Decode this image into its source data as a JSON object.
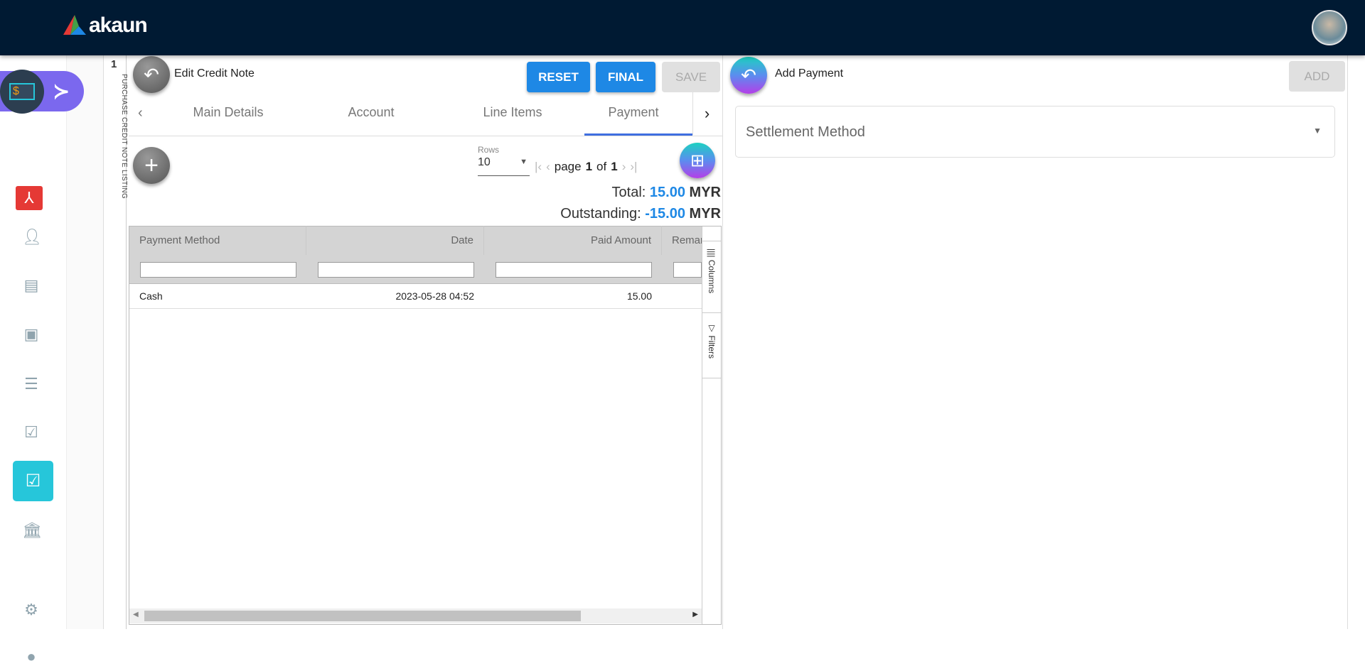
{
  "app": {
    "logo_text": "akaun"
  },
  "sidebar": {
    "items": [
      "billing",
      "pdf",
      "contacts",
      "card",
      "display",
      "receipt",
      "doc-check",
      "credit-note",
      "bank",
      "settings",
      "profile"
    ]
  },
  "vertical_tab": {
    "count": "1",
    "label": "PURCHASE CREDIT NOTE LISTING"
  },
  "edit": {
    "title": "Edit Credit Note",
    "reset": "RESET",
    "final": "FINAL",
    "save": "SAVE",
    "tabs": [
      "Main Details",
      "Account",
      "Line Items",
      "Payment"
    ],
    "rows_label": "Rows",
    "rows_value": "10",
    "page_word": "page",
    "page": "1",
    "of_word": "of",
    "pages": "1",
    "total_label": "Total:",
    "total_value": "15.00",
    "total_currency": "MYR",
    "outstanding_label": "Outstanding:",
    "outstanding_value": "-15.00",
    "outstanding_currency": "MYR",
    "columns": [
      "Payment Method",
      "Date",
      "Paid Amount",
      "Remarks"
    ],
    "rows": [
      {
        "method": "Cash",
        "date": "2023-05-28 04:52",
        "amount": "15.00",
        "remarks": ""
      }
    ],
    "side_columns": "Columns",
    "side_filters": "Filters"
  },
  "payment": {
    "title": "Add Payment",
    "add": "ADD",
    "settlement_placeholder": "Settlement Method"
  },
  "colors": {
    "header": "#001a33",
    "accent": "#1e88e5",
    "active": "#26c6da",
    "pill": "#7b68ee"
  }
}
